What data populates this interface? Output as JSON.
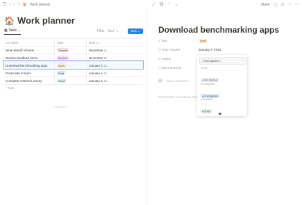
{
  "topbar": {
    "breadcrumb": "Work planner",
    "share_label": "Share",
    "page_icon": "🏠"
  },
  "planner": {
    "title": "Work planner",
    "icon": "🏠",
    "view_tab": "Table",
    "filter_label": "Filter",
    "sort_label": "Sort",
    "new_label": "New",
    "columns": [
      "Aa Name",
      "Tags",
      "Date cr..."
    ],
    "rows": [
      {
        "name": "Write kickoff scheme",
        "tag": "Tutorial",
        "tag_bg": "#f4dfeb",
        "tag_color": "#6c3756",
        "date": "December 2..."
      },
      {
        "name": "Review feedback items",
        "tag": "Review",
        "tag_bg": "#f4dfeb",
        "tag_color": "#6c3756",
        "date": "December 3..."
      },
      {
        "name": "Download benchmarking apps",
        "tag": "Apps",
        "tag_bg": "#fbedd6",
        "tag_color": "#8a5a1a",
        "date": "January 4, 2..."
      },
      {
        "name": "Post invite to team",
        "tag": "Post",
        "tag_bg": "#dce8f3",
        "tag_color": "#294b67",
        "date": "January 4, 2..."
      },
      {
        "name": "Complete research survey",
        "tag": "Send",
        "tag_bg": "#dff0e6",
        "tag_color": "#2a5b3b",
        "date": "January 5, 2..."
      }
    ],
    "new_row": "+ New",
    "calculate": "Calculate ⌄"
  },
  "page": {
    "title": "Download benchmarking apps",
    "properties": [
      {
        "label": "≡ Tags",
        "value": "Apps",
        "is_tag": true
      },
      {
        "label": "◷ Date created",
        "value": "January 4, 2023",
        "is_tag": false
      },
      {
        "label": "☀ Status",
        "value": "",
        "is_tag": false
      },
      {
        "label": "+ Add a property",
        "value": "",
        "is_tag": false
      }
    ],
    "comment_placeholder": "Add a comment...",
    "hint": "Press Enter to continue with an empty page"
  },
  "status_menu": {
    "current": "Not started",
    "groups": [
      {
        "label": "To-do",
        "option": "Not started",
        "bg": "#efefee",
        "color": "#5a5a5a"
      },
      {
        "label": "In progress",
        "option": "In progress",
        "bg": "#dce8f3",
        "color": "#294b67"
      },
      {
        "label": "Complete",
        "option": "Done",
        "bg": "#dff0e6",
        "color": "#2a5b3b"
      }
    ]
  },
  "colors": {
    "accent": "#2383e2",
    "selected_row_outline": "#7aa7ff"
  }
}
